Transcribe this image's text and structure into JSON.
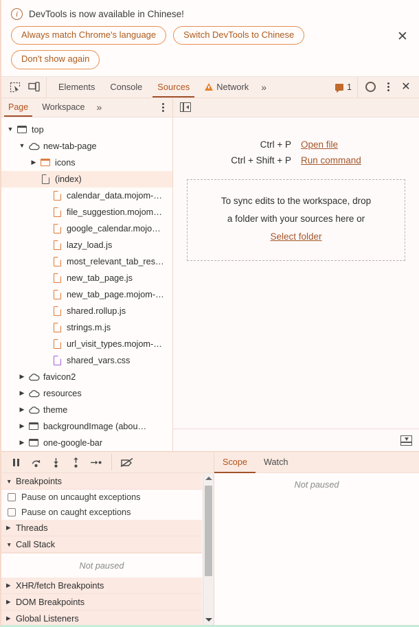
{
  "banner": {
    "icon": "info-icon",
    "message": "DevTools is now available in Chinese!",
    "buttons": [
      {
        "label": "Always match Chrome's language"
      },
      {
        "label": "Switch DevTools to Chinese"
      },
      {
        "label": "Don't show again"
      }
    ],
    "close_label": "✕"
  },
  "toolbar": {
    "inspect_icon": "inspect-element-icon",
    "device_icon": "device-toolbar-icon",
    "tabs": [
      {
        "label": "Elements",
        "active": false,
        "warning": false
      },
      {
        "label": "Console",
        "active": false,
        "warning": false
      },
      {
        "label": "Sources",
        "active": true,
        "warning": false
      },
      {
        "label": "Network",
        "active": false,
        "warning": true
      }
    ],
    "more_tabs_label": "»",
    "issues_count": "1",
    "issues_icon": "issues-message-icon",
    "settings_icon": "gear-icon",
    "menu_icon": "kebab-menu-icon",
    "close_label": "✕"
  },
  "navigator_toolbar": {
    "tabs": [
      {
        "label": "Page",
        "active": true
      },
      {
        "label": "Workspace",
        "active": false
      }
    ],
    "more_label": "»",
    "menu_icon": "kebab-menu-icon",
    "panel_toggle_icon": "show-navigator-icon"
  },
  "tree": [
    {
      "label": "top",
      "indent": 0,
      "twisty": "open",
      "icon": "frame"
    },
    {
      "label": "new-tab-page",
      "indent": 1,
      "twisty": "open",
      "icon": "cloud"
    },
    {
      "label": "icons",
      "indent": 2,
      "twisty": "closed",
      "icon": "folder"
    },
    {
      "label": "(index)",
      "indent": 2,
      "twisty": "none",
      "icon": "doc",
      "selected": true
    },
    {
      "label": "calendar_data.mojom-…",
      "indent": 3,
      "twisty": "none",
      "icon": "file"
    },
    {
      "label": "file_suggestion.mojom…",
      "indent": 3,
      "twisty": "none",
      "icon": "file"
    },
    {
      "label": "google_calendar.mojo…",
      "indent": 3,
      "twisty": "none",
      "icon": "file"
    },
    {
      "label": "lazy_load.js",
      "indent": 3,
      "twisty": "none",
      "icon": "file"
    },
    {
      "label": "most_relevant_tab_res…",
      "indent": 3,
      "twisty": "none",
      "icon": "file"
    },
    {
      "label": "new_tab_page.js",
      "indent": 3,
      "twisty": "none",
      "icon": "file"
    },
    {
      "label": "new_tab_page.mojom-…",
      "indent": 3,
      "twisty": "none",
      "icon": "file"
    },
    {
      "label": "shared.rollup.js",
      "indent": 3,
      "twisty": "none",
      "icon": "file"
    },
    {
      "label": "strings.m.js",
      "indent": 3,
      "twisty": "none",
      "icon": "file"
    },
    {
      "label": "url_visit_types.mojom-…",
      "indent": 3,
      "twisty": "none",
      "icon": "file"
    },
    {
      "label": "shared_vars.css",
      "indent": 3,
      "twisty": "none",
      "icon": "css"
    },
    {
      "label": "favicon2",
      "indent": 1,
      "twisty": "closed",
      "icon": "cloud"
    },
    {
      "label": "resources",
      "indent": 1,
      "twisty": "closed",
      "icon": "cloud"
    },
    {
      "label": "theme",
      "indent": 1,
      "twisty": "closed",
      "icon": "cloud"
    },
    {
      "label": "backgroundImage (abou…",
      "indent": 1,
      "twisty": "closed",
      "icon": "frame"
    },
    {
      "label": "one-google-bar",
      "indent": 1,
      "twisty": "closed",
      "icon": "frame"
    }
  ],
  "editor": {
    "shortcuts": [
      {
        "keys": "Ctrl + P",
        "action": "Open file"
      },
      {
        "keys": "Ctrl + Shift + P",
        "action": "Run command"
      }
    ],
    "dropzone": {
      "line1": "To sync edits to the workspace, drop",
      "line2": "a folder with your sources here or",
      "link": "Select folder"
    },
    "drawer_icon": "show-drawer-icon"
  },
  "debugger": {
    "controls": [
      {
        "name": "pause-script-execution",
        "icon": "pause-icon"
      },
      {
        "name": "step-over",
        "icon": "step-over-icon"
      },
      {
        "name": "step-into",
        "icon": "step-into-icon"
      },
      {
        "name": "step-out",
        "icon": "step-out-icon"
      },
      {
        "name": "step",
        "icon": "step-icon"
      },
      {
        "name": "deactivate-breakpoints",
        "icon": "deactivate-breakpoints-icon"
      }
    ],
    "sections": [
      {
        "label": "Breakpoints",
        "twisty": "open"
      },
      {
        "label": "Threads",
        "twisty": "closed"
      },
      {
        "label": "Call Stack",
        "twisty": "open"
      },
      {
        "label": "XHR/fetch Breakpoints",
        "twisty": "closed"
      },
      {
        "label": "DOM Breakpoints",
        "twisty": "closed"
      },
      {
        "label": "Global Listeners",
        "twisty": "closed"
      }
    ],
    "checkboxes": [
      {
        "label": "Pause on uncaught exceptions",
        "checked": false
      },
      {
        "label": "Pause on caught exceptions",
        "checked": false
      }
    ],
    "call_stack_status": "Not paused"
  },
  "scope": {
    "tabs": [
      {
        "label": "Scope",
        "active": true
      },
      {
        "label": "Watch",
        "active": false
      }
    ],
    "status": "Not paused"
  },
  "colors": {
    "accent": "#a0522d",
    "link": "#a1572a",
    "warning": "#e8832a",
    "file_icon": "#e07a35",
    "css_icon": "#a45fe0",
    "selected_row": "#fdebe1"
  }
}
